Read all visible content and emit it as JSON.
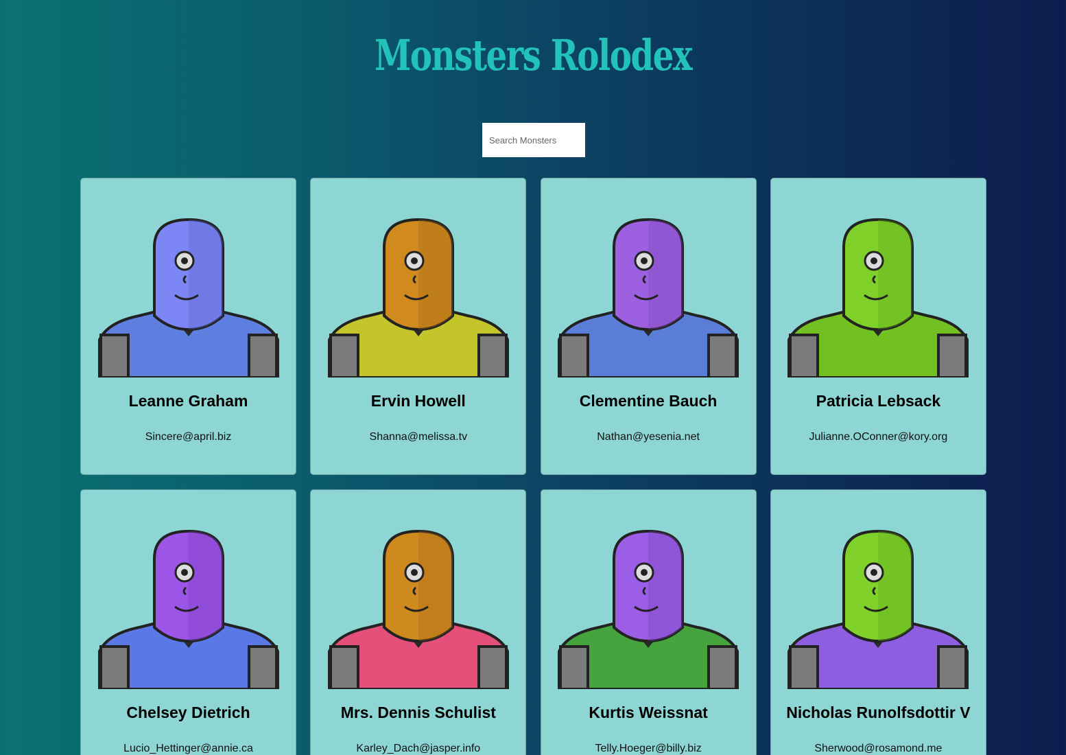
{
  "app": {
    "title": "Monsters Rolodex"
  },
  "search": {
    "placeholder": "Search Monsters",
    "value": ""
  },
  "monsters": [
    {
      "name": "Leanne Graham",
      "email": "Sincere@april.biz",
      "skin": "#7d86f5",
      "shade": "#5a63cf",
      "body": "#5f7fe0",
      "icon": "monster-avatar-icon"
    },
    {
      "name": "Ervin Howell",
      "email": "Shanna@melissa.tv",
      "skin": "#d08a1e",
      "shade": "#a36714",
      "body": "#c3c52a",
      "icon": "monster-avatar-icon"
    },
    {
      "name": "Clementine Bauch",
      "email": "Nathan@yesenia.net",
      "skin": "#9d60e0",
      "shade": "#7a44b8",
      "body": "#5a7ed8",
      "icon": "monster-avatar-icon"
    },
    {
      "name": "Patricia Lebsack",
      "email": "Julianne.OConner@kory.org",
      "skin": "#7fd12a",
      "shade": "#5ea81a",
      "body": "#72c022",
      "icon": "monster-avatar-icon"
    },
    {
      "name": "Chelsey Dietrich",
      "email": "Lucio_Hettinger@annie.ca",
      "skin": "#9d55e8",
      "shade": "#7a3cc0",
      "body": "#5a78e6",
      "icon": "monster-avatar-icon"
    },
    {
      "name": "Mrs. Dennis Schulist",
      "email": "Karley_Dach@jasper.info",
      "skin": "#cf8a1f",
      "shade": "#a66814",
      "body": "#e4507a",
      "icon": "monster-avatar-icon"
    },
    {
      "name": "Kurtis Weissnat",
      "email": "Telly.Hoeger@billy.biz",
      "skin": "#9c5ee6",
      "shade": "#7a42bf",
      "body": "#46a43e",
      "icon": "monster-avatar-icon"
    },
    {
      "name": "Nicholas Runolfsdottir V",
      "email": "Sherwood@rosamond.me",
      "skin": "#80d22b",
      "shade": "#5ea81a",
      "body": "#8d5ee0",
      "icon": "monster-avatar-icon"
    }
  ]
}
